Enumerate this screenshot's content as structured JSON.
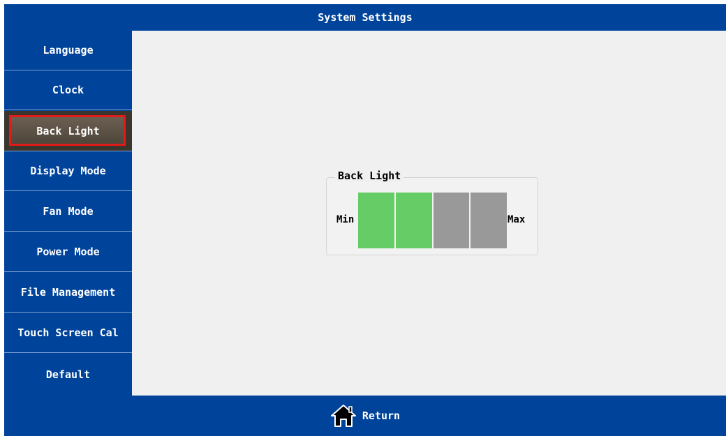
{
  "title": "System Settings",
  "sidebar": {
    "items": [
      {
        "label": "Language",
        "active": false
      },
      {
        "label": "Clock",
        "active": false
      },
      {
        "label": "Back Light",
        "active": true
      },
      {
        "label": "Display Mode",
        "active": false
      },
      {
        "label": "Fan Mode",
        "active": false
      },
      {
        "label": "Power Mode",
        "active": false
      },
      {
        "label": "File Management",
        "active": false
      },
      {
        "label": "Touch Screen Cal",
        "active": false
      },
      {
        "label": "Default",
        "active": false
      }
    ]
  },
  "backlight": {
    "group_title": "Back Light",
    "min_label": "Min",
    "max_label": "Max",
    "level": 2,
    "max_level": 4,
    "on_color": "#66cc66",
    "off_color": "#999999"
  },
  "footer": {
    "return_label": "Return",
    "icon": "home-icon"
  },
  "colors": {
    "header": "#00439a",
    "selection_border": "#e11a1a"
  }
}
